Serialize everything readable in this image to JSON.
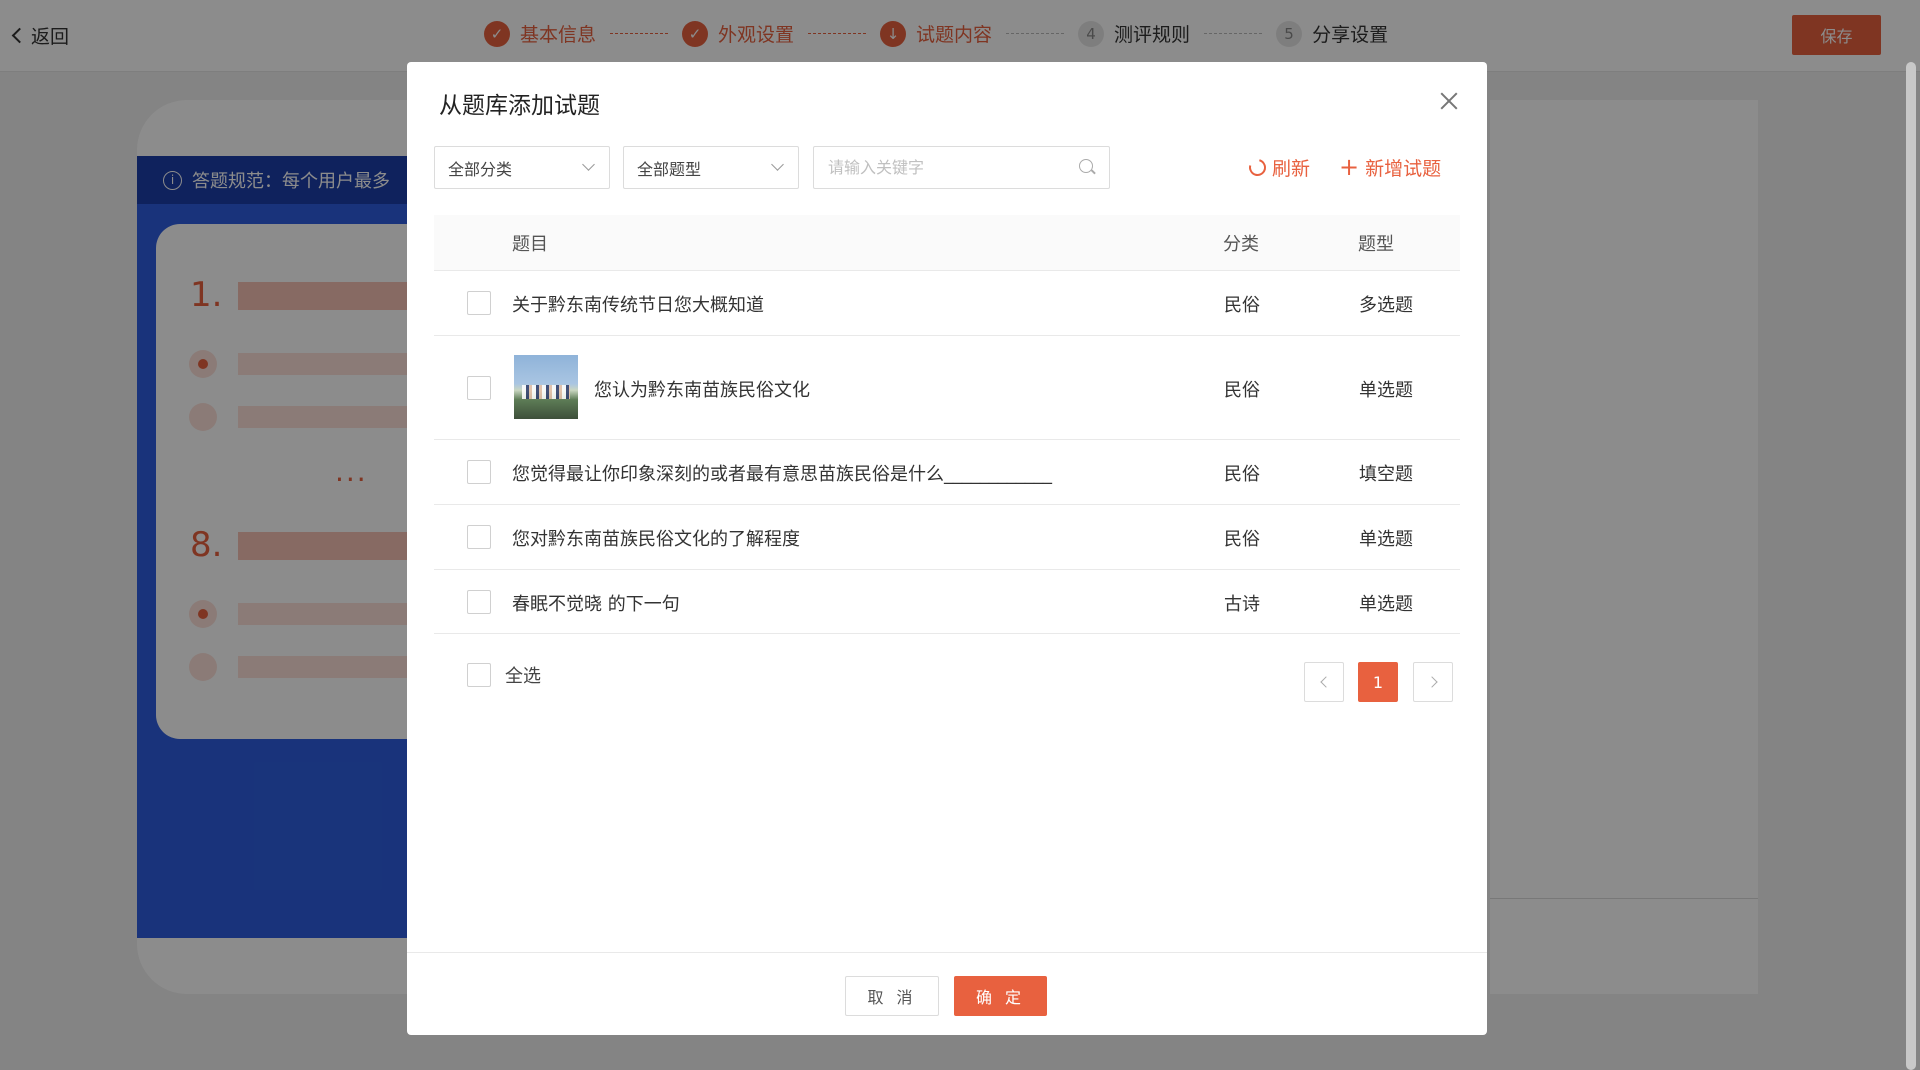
{
  "header": {
    "back_label": "返回",
    "save_label": "保存",
    "steps": [
      {
        "index": "1",
        "label": "基本信息",
        "status": "done"
      },
      {
        "index": "2",
        "label": "外观设置",
        "status": "done"
      },
      {
        "index": "3",
        "label": "试题内容",
        "status": "current"
      },
      {
        "index": "4",
        "label": "测评规则",
        "status": "todo"
      },
      {
        "index": "5",
        "label": "分享设置",
        "status": "todo"
      }
    ]
  },
  "preview": {
    "notice": "答题规范：每个用户最多",
    "q_first": "1.",
    "q_last": "8.",
    "ellipsis": "..."
  },
  "modal": {
    "title": "从题库添加试题",
    "filters": {
      "category": "全部分类",
      "type": "全部题型",
      "search_placeholder": "请输入关键字"
    },
    "refresh_label": "刷新",
    "add_label": "新增试题",
    "table": {
      "headers": {
        "title": "题目",
        "category": "分类",
        "type": "题型"
      },
      "rows": [
        {
          "title": "关于黔东南传统节日您大概知道",
          "category": "民俗",
          "type": "多选题",
          "has_image": false
        },
        {
          "title": "您认为黔东南苗族民俗文化",
          "category": "民俗",
          "type": "单选题",
          "has_image": true
        },
        {
          "title": "您觉得最让你印象深刻的或者最有意思苗族民俗是什么____________",
          "category": "民俗",
          "type": "填空题",
          "has_image": false
        },
        {
          "title": "您对黔东南苗族民俗文化的了解程度",
          "category": "民俗",
          "type": "单选题",
          "has_image": false
        },
        {
          "title": "春眠不觉晓 的下一句",
          "category": "古诗",
          "type": "单选题",
          "has_image": false
        }
      ]
    },
    "select_all_label": "全选",
    "pagination": {
      "current": "1"
    },
    "cancel_label": "取 消",
    "ok_label": "确 定"
  },
  "colors": {
    "accent": "#e8613f",
    "notice_bg": "#1d3fa9",
    "phone_bg": "#2e5ee0"
  }
}
